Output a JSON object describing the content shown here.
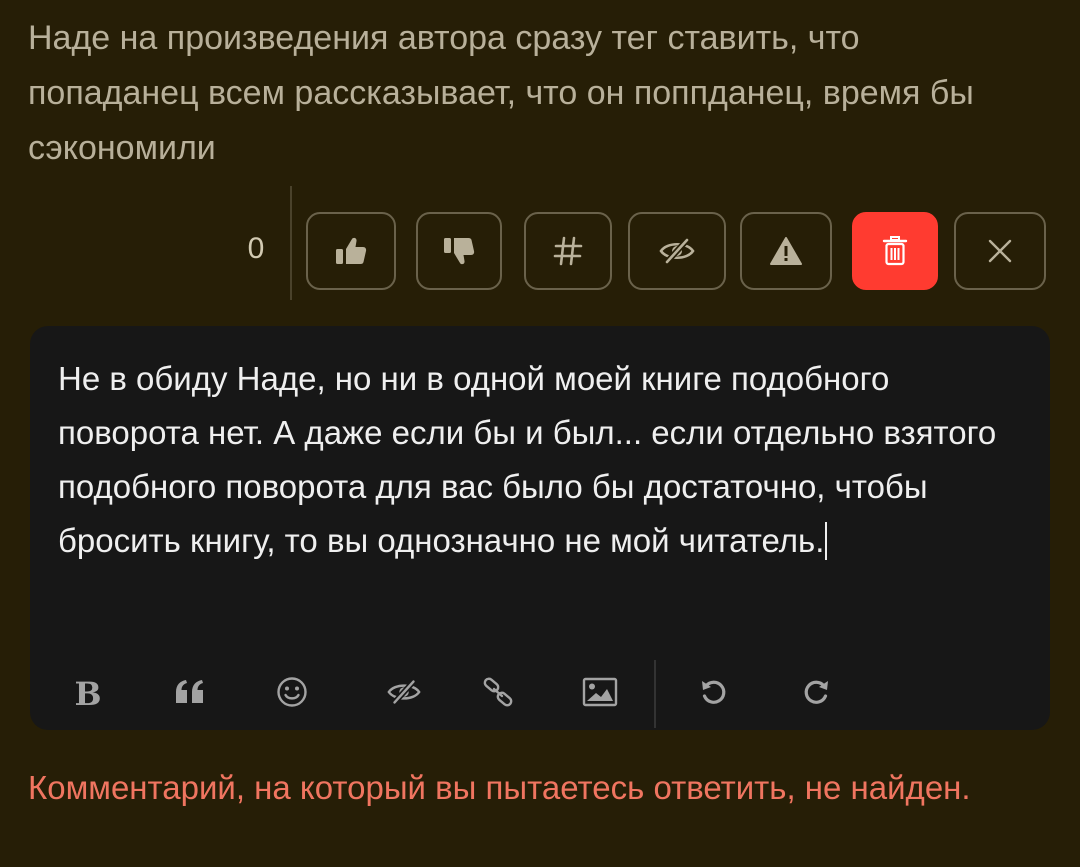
{
  "parent_comment": {
    "text": "Наде на произведения автора сразу тег ставить, что попаданец всем рассказывает, что он поппданец, время бы сэкономили"
  },
  "actions": {
    "rating": "0",
    "buttons": [
      {
        "name": "like-button",
        "icon": "thumbs-up-icon"
      },
      {
        "name": "dislike-button",
        "icon": "thumbs-down-icon"
      },
      {
        "name": "link-button",
        "icon": "hash-icon",
        "label": "#"
      },
      {
        "name": "hide-button",
        "icon": "eye-slash-icon"
      },
      {
        "name": "report-button",
        "icon": "warning-icon"
      },
      {
        "name": "delete-button",
        "icon": "trash-icon",
        "color": "#ff3b30"
      },
      {
        "name": "close-button",
        "icon": "close-icon"
      }
    ]
  },
  "editor": {
    "text": "Не в обиду Наде, но ни в одной моей книге подобного поворота нет. А даже если бы и был... если отдельно взятого подобного поворота для вас было бы достаточно, чтобы бросить книгу, то вы однозначно не мой читатель.",
    "toolbar": [
      {
        "name": "bold-button",
        "icon": "bold-icon",
        "label": "B"
      },
      {
        "name": "quote-button",
        "icon": "quote-icon"
      },
      {
        "name": "emoji-button",
        "icon": "smiley-icon"
      },
      {
        "name": "spoiler-button",
        "icon": "eye-slash-icon"
      },
      {
        "name": "link-button",
        "icon": "link-icon"
      },
      {
        "name": "image-button",
        "icon": "image-icon"
      },
      {
        "name": "undo-button",
        "icon": "undo-icon"
      },
      {
        "name": "redo-button",
        "icon": "redo-icon"
      }
    ]
  },
  "error": {
    "message": "Комментарий, на который вы пытаетесь ответить, не найден."
  },
  "colors": {
    "background": "#261e06",
    "editor_bg": "#171717",
    "danger": "#ff3b30",
    "error_text": "#f07560"
  }
}
